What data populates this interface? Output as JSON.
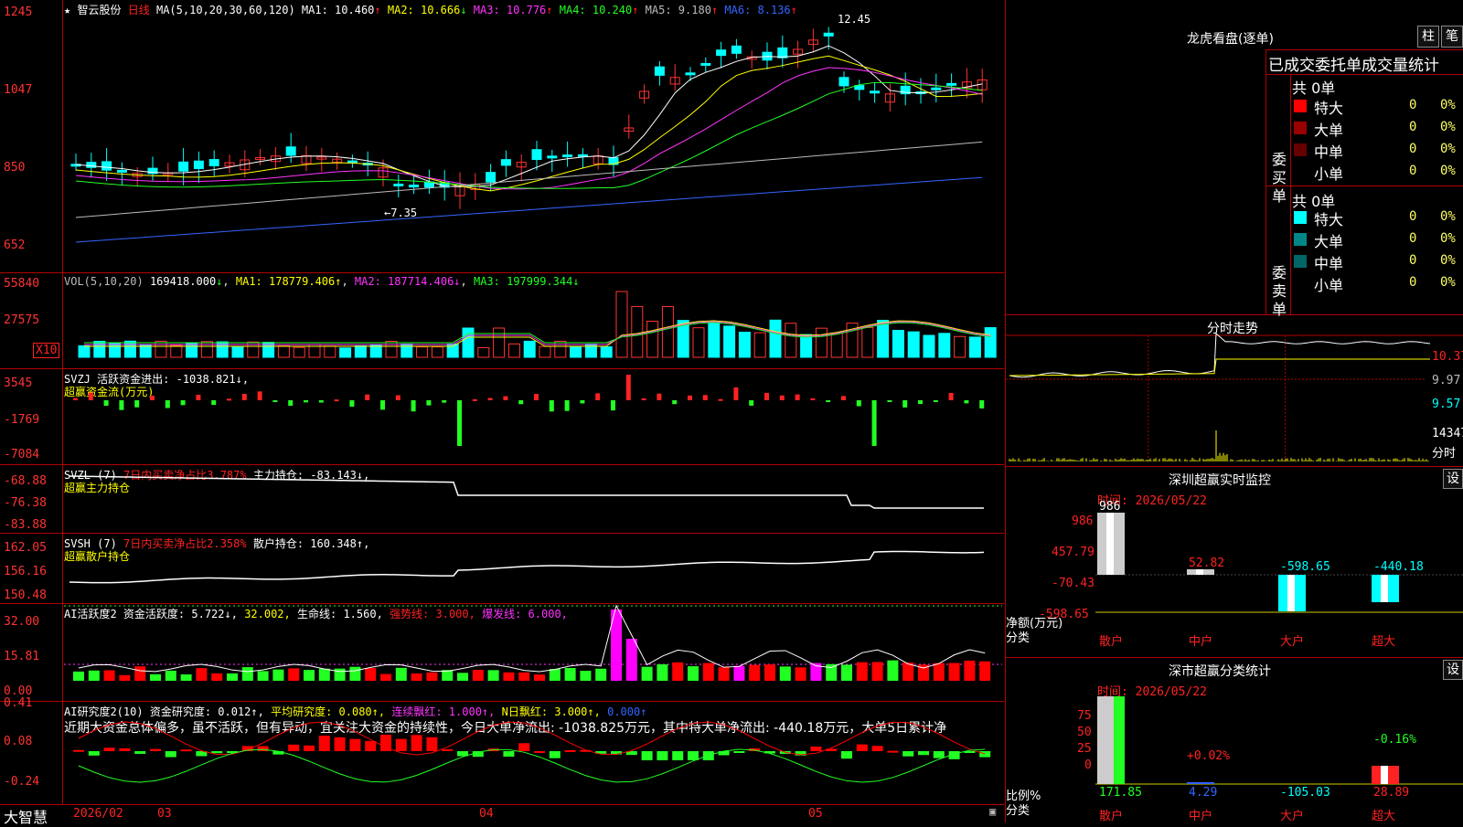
{
  "main": {
    "star": "★",
    "stock_name": "智云股份",
    "period": "日线",
    "ma_header": "MA(5,10,20,30,60,120)",
    "ma_values": [
      {
        "label": "MA1:",
        "value": "10.460",
        "arrow": "↑",
        "color": "#ffffff"
      },
      {
        "label": "MA2:",
        "value": "10.666",
        "arrow": "↓",
        "color": "#ffff00"
      },
      {
        "label": "MA3:",
        "value": "10.776",
        "arrow": "↑",
        "color": "#ff33ff"
      },
      {
        "label": "MA4:",
        "value": "10.240",
        "arrow": "↑",
        "color": "#22ff22"
      },
      {
        "label": "MA5:",
        "value": "9.180",
        "arrow": "↑",
        "color": "#bbbbbb"
      },
      {
        "label": "MA6:",
        "value": "8.136",
        "arrow": "↑",
        "color": "#3366ff"
      }
    ],
    "y_ticks": [
      "1245",
      "1047",
      "850",
      "652"
    ],
    "high_label": "12.45",
    "low_label": "←7.35"
  },
  "vol": {
    "header": "VOL(5,10,20)",
    "value": "169418.000",
    "value_arrow": "↓",
    "ma1": "MA1: 178779.406↑",
    "ma2": "MA2: 187714.406↓",
    "ma3": "MA3: 197999.344↓",
    "y_ticks": [
      "55840",
      "27575"
    ],
    "unit": "X10"
  },
  "svzj": {
    "header": "SVZJ",
    "line1": "活跃资金进出: -1038.821↓,",
    "line2": "超赢资金流(万元)",
    "y_ticks": [
      "3545",
      "-1769",
      "-7084"
    ]
  },
  "svzl": {
    "header": "SVZL (7)",
    "red_text": "7日内买卖净占比3.787%",
    "main_text": "主力持仓: -83.143↓,",
    "line2": "超赢主力持仓",
    "y_ticks": [
      "-68.88",
      "-76.38",
      "-83.88"
    ]
  },
  "svsh": {
    "header": "SVSH (7)",
    "red_text": "7日内买卖净占比2.358%",
    "main_text": "散户持仓: 160.348↑,",
    "line2": "超赢散户持仓",
    "y_ticks": [
      "162.05",
      "156.16",
      "150.48"
    ]
  },
  "ai_active": {
    "header": "AI活跃度2",
    "text1": "资金活跃度: 5.722↓,",
    "text2": "32.002,",
    "text3": "生命线: 1.560,",
    "text4": "强势线: 3.000,",
    "text5": "爆发线: 6.000,",
    "y_ticks": [
      "32.00",
      "15.81",
      "0.00"
    ]
  },
  "ai_research": {
    "header": "AI研究度2(10)",
    "text1": "资金研究度: 0.012↑,",
    "text2": "平均研究度: 0.080↑,",
    "text3": "连续飘红: 1.000↑,",
    "text4": "N日飘红: 3.000↑,",
    "text5": "0.000↑",
    "comment": "近期大资金总体偏多，虽不活跃，但有异动，宜关注大资金的持续性，今日大单净流出: -1038.825万元，其中特大单净流出: -440.18万元，大单5日累计净",
    "y_ticks": [
      "0.41",
      "0.08",
      "-0.24"
    ]
  },
  "footer": {
    "brand": "大智慧",
    "date_labels": [
      "2026/02",
      "03",
      "04",
      "05"
    ]
  },
  "dragon": {
    "title": "龙虎看盘(逐单)",
    "btn1": "柱",
    "btn2": "笔",
    "subtitle": "已成交委托单成交量统计",
    "buy_label": "委买单",
    "sell_label": "委卖单",
    "buy_total": "共 0单",
    "sell_total": "共 0单",
    "buy_rows": [
      {
        "name": "特大",
        "count": "0",
        "pct": "0%",
        "color": "#ff0000"
      },
      {
        "name": "大单",
        "count": "0",
        "pct": "0%",
        "color": "#990000"
      },
      {
        "name": "中单",
        "count": "0",
        "pct": "0%",
        "color": "#660000"
      },
      {
        "name": "小单",
        "count": "0",
        "pct": "0%",
        "color": "#000000"
      }
    ],
    "sell_rows": [
      {
        "name": "特大",
        "count": "0",
        "pct": "0%",
        "color": "#00ffff"
      },
      {
        "name": "大单",
        "count": "0",
        "pct": "0%",
        "color": "#008888"
      },
      {
        "name": "中单",
        "count": "0",
        "pct": "0%",
        "color": "#006666"
      },
      {
        "name": "小单",
        "count": "0",
        "pct": "0%",
        "color": "#000000"
      }
    ]
  },
  "intraday": {
    "title": "分时走势",
    "prices": [
      "10.37",
      "9.97",
      "9.57"
    ],
    "volume": "14347",
    "unit": "分时"
  },
  "sz_monitor": {
    "title": "深圳超赢实时监控",
    "btn": "设",
    "time": "时间: 2026/05/22",
    "y_ticks": [
      "986",
      "457.79",
      "-70.43",
      "-598.65"
    ],
    "axis_label": "净额(万元)",
    "cat_label": "分类",
    "categories": [
      "散户",
      "中户",
      "大户",
      "超大"
    ],
    "values": [
      "986",
      "52.82",
      "-598.65",
      "-440.18"
    ]
  },
  "sz_class": {
    "title": "深市超赢分类统计",
    "btn": "设",
    "time": "时间: 2026/05/22",
    "y_ticks": [
      "75",
      "50",
      "25",
      "0"
    ],
    "axis_label": "比例%",
    "cat_label": "分类",
    "categories": [
      "散户",
      "中户",
      "大户",
      "超大"
    ],
    "pct_labels": [
      "",
      "+0.02%",
      "",
      "-0.16%"
    ],
    "values": [
      "171.85",
      "4.29",
      "-105.03",
      "28.89"
    ]
  }
}
